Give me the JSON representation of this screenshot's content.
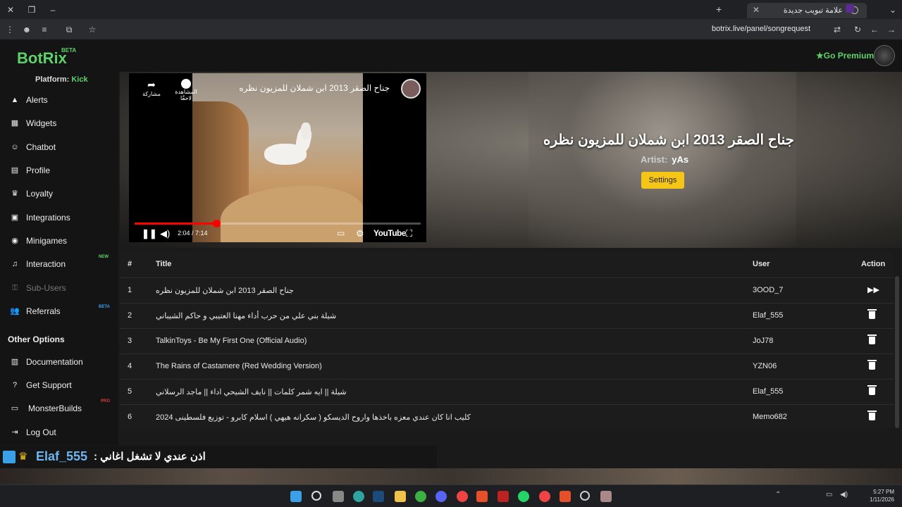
{
  "browser": {
    "tab_title": "علامة تبويب جديدة",
    "url": "botrix.live/panel/songrequest"
  },
  "header": {
    "logo": "BotRix",
    "logo_badge": "BETA",
    "go_premium": "Go Premium"
  },
  "sidebar": {
    "platform_label": "Platform:",
    "platform_value": "Kick",
    "items": [
      {
        "label": "Alerts",
        "icon": "warning-icon"
      },
      {
        "label": "Widgets",
        "icon": "grid-icon"
      },
      {
        "label": "Chatbot",
        "icon": "robot-icon"
      },
      {
        "label": "Profile",
        "icon": "id-card-icon"
      },
      {
        "label": "Loyalty",
        "icon": "trophy-icon"
      },
      {
        "label": "Integrations",
        "icon": "plug-icon"
      },
      {
        "label": "Minigames",
        "icon": "gamepad-icon"
      },
      {
        "label": "Interaction",
        "icon": "music-icon",
        "badge": "NEW"
      },
      {
        "label": "Sub-Users",
        "icon": "key-icon"
      },
      {
        "label": "Referrals",
        "icon": "users-icon",
        "badge": "BETA"
      }
    ],
    "other_title": "Other Options",
    "other_items": [
      {
        "label": "Documentation",
        "icon": "book-icon"
      },
      {
        "label": "Get Support",
        "icon": "question-icon"
      },
      {
        "label": "MonsterBuilds",
        "icon": "laptop-icon",
        "badge": "PRO"
      },
      {
        "label": "Log Out",
        "icon": "logout-icon"
      }
    ]
  },
  "player": {
    "video_title": "جناح الصقر 2013 ابن شملان للمزيون نظره",
    "share_label": "مشاركة",
    "later_label": "المشاهدة لاحقًا",
    "time": "2:04 / 7:14",
    "progress": 0.286,
    "brand": "YouTube"
  },
  "now_playing": {
    "title": "جناح الصقر 2013 ابن شملان للمزيون نظره",
    "artist_label": "Artist:",
    "artist": "yAs",
    "settings_label": "Settings"
  },
  "queue": {
    "headers": {
      "num": "#",
      "title": "Title",
      "user": "User",
      "action": "Action"
    },
    "rows": [
      {
        "num": "1",
        "title": "جناح الصقر 2013 ابن شملان للمزيون نظره",
        "user": "3OOD_7",
        "action": "skip"
      },
      {
        "num": "2",
        "title": "شيلة بني علي من حرب أداء مهنا العتيبي و حاكم الشيباني",
        "user": "Elaf_555",
        "action": "delete"
      },
      {
        "num": "3",
        "title": "TalkinToys - Be My First One (Official Audio)",
        "user": "JoJ78",
        "action": "delete"
      },
      {
        "num": "4",
        "title": "The Rains of Castamere (Red Wedding Version)",
        "user": "YZN06",
        "action": "delete"
      },
      {
        "num": "5",
        "title": "شيلة || ايه شمر كلمات || نايف الشيحي اداء || ماجد الرسلاني",
        "user": "Elaf_555",
        "action": "delete"
      },
      {
        "num": "6",
        "title": "كليب انا كان عندي معزه باخذها واروح الديسكو ( سكرانه هيهي ) اسلام كابرو - توزيع فلسطينى 2024",
        "user": "Memo682",
        "action": "delete"
      }
    ]
  },
  "chat": {
    "username": "Elaf_555",
    "message": ": اذن عندي لا تشغل اغاني"
  },
  "taskbar": {
    "time": "5:27 PM",
    "date": "1/11/2026"
  },
  "colors": {
    "accent": "#5fd16a",
    "settings_button": "#f5c518",
    "yt_red": "#ff0000"
  }
}
